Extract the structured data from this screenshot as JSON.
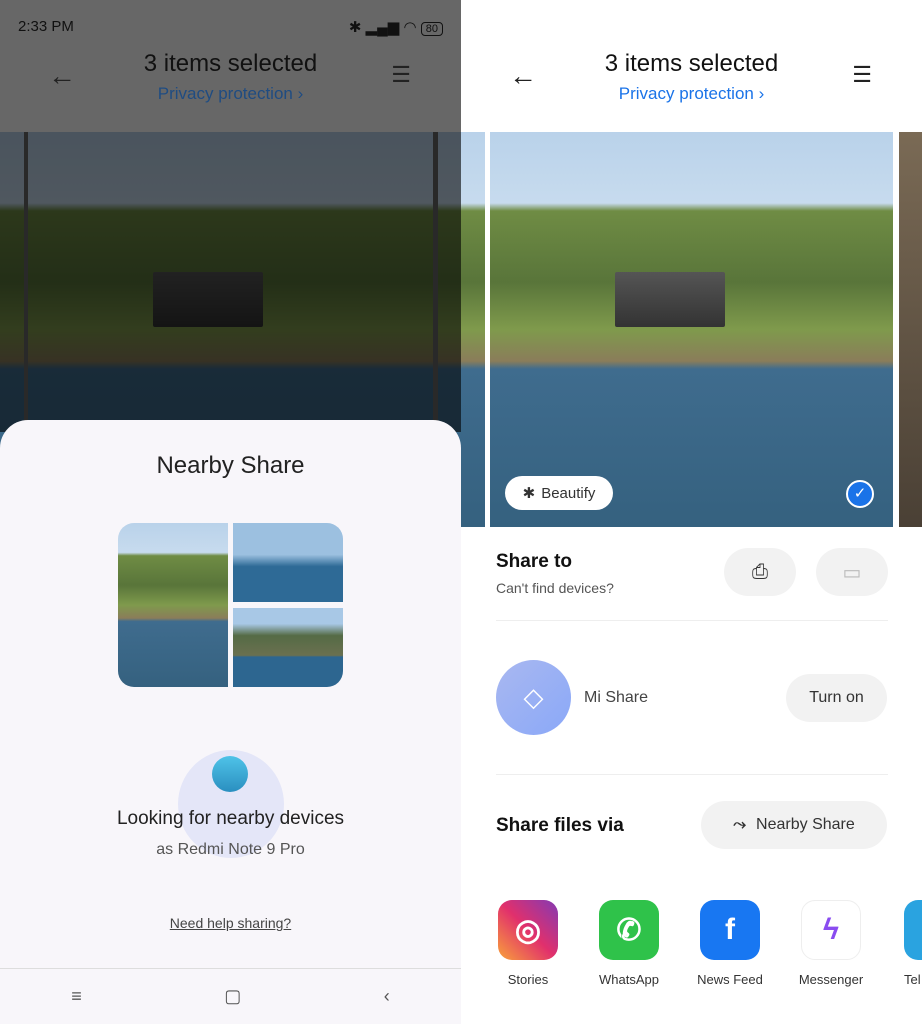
{
  "left": {
    "status": {
      "time": "2:33 PM",
      "battery": "80"
    },
    "header": {
      "title": "3 items selected",
      "subtitle": "Privacy protection ›"
    },
    "sheet": {
      "title": "Nearby Share",
      "status": "Looking for nearby devices",
      "device": "as Redmi Note 9 Pro",
      "help_link": "Need help sharing?"
    },
    "nav": [
      "≡",
      "▢",
      "‹"
    ]
  },
  "right": {
    "header": {
      "title": "3 items selected",
      "subtitle": "Privacy protection ›"
    },
    "beautify": "Beautify",
    "share_to": {
      "title": "Share to",
      "subtitle": "Can't find devices?"
    },
    "mi_share": {
      "label": "Mi Share",
      "button": "Turn on"
    },
    "share_files": {
      "title": "Share files via",
      "button": "Nearby Share"
    },
    "apps": [
      {
        "label": "Stories"
      },
      {
        "label": "WhatsApp"
      },
      {
        "label": "News Feed"
      },
      {
        "label": "Messenger"
      },
      {
        "label": "Tel"
      }
    ]
  },
  "colors": {
    "accent": "#1a73e8",
    "mi_share": "#9db3f5"
  }
}
